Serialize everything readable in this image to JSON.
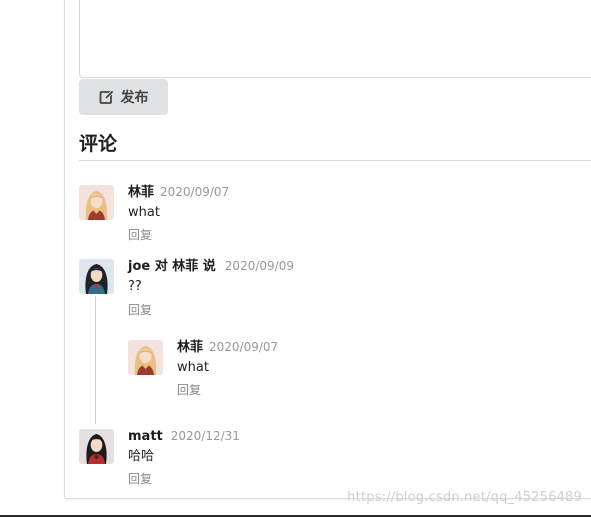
{
  "editor": {
    "publish_label": "发布",
    "publish_icon": "edit-icon"
  },
  "comments_section": {
    "title": "评论"
  },
  "comments": [
    {
      "author": "林菲",
      "date": "2020/09/07",
      "text": "what",
      "reply_label": "回复",
      "avatar": "avatar-blonde-woman"
    },
    {
      "author": "joe 对 林菲 说",
      "date": "2020/09/09",
      "text": "??",
      "reply_label": "回复",
      "avatar": "avatar-dark-hair-woman"
    },
    {
      "author": "林菲",
      "date": "2020/09/07",
      "text": "what",
      "reply_label": "回复",
      "avatar": "avatar-blonde-woman"
    },
    {
      "author": "matt",
      "date": "2020/12/31",
      "text": "哈哈",
      "reply_label": "回复",
      "avatar": "avatar-dark-hair-woman-red"
    }
  ],
  "watermark": "https://blog.csdn.net/qq_45256489",
  "colors": {
    "button_bg": "#e0e1e2",
    "muted_text": "#999999",
    "divider": "#dcdcdc"
  }
}
